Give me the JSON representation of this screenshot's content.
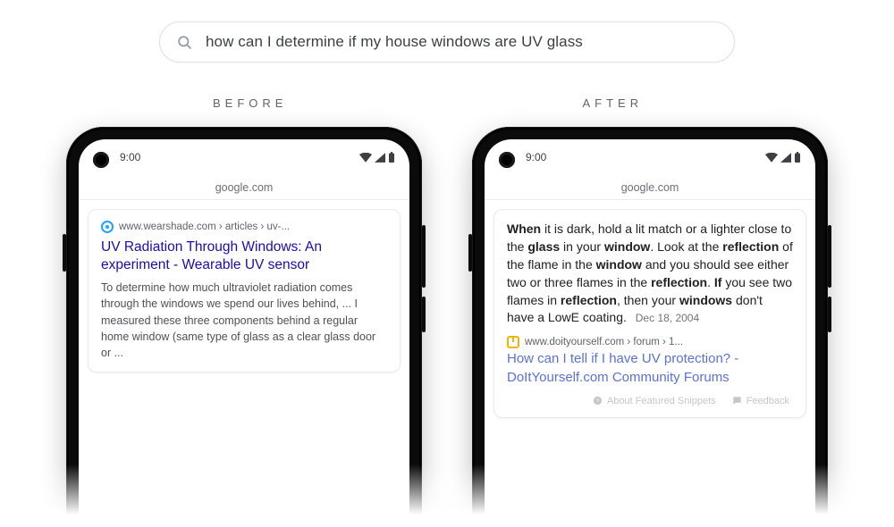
{
  "search": {
    "query": "how can I determine if my house windows are UV glass"
  },
  "labels": {
    "before": "BEFORE",
    "after": "AFTER"
  },
  "phone_common": {
    "time": "9:00",
    "url": "google.com"
  },
  "before": {
    "breadcrumb": "www.wearshade.com › articles › uv-...",
    "title": "UV Radiation Through Windows: An experiment - Wearable UV sensor",
    "snippet": "To determine how much ultraviolet radiation comes through the windows we spend our lives behind, ... I measured these three components behind a regular home window (same type of glass as a clear glass door or  ..."
  },
  "after": {
    "snippet_parts": [
      {
        "b": true,
        "t": "When"
      },
      {
        "b": false,
        "t": " it is dark, hold a lit match or a lighter close to the "
      },
      {
        "b": true,
        "t": "glass"
      },
      {
        "b": false,
        "t": " in your "
      },
      {
        "b": true,
        "t": "window"
      },
      {
        "b": false,
        "t": ". Look at the "
      },
      {
        "b": true,
        "t": "reflection"
      },
      {
        "b": false,
        "t": " of the flame in the "
      },
      {
        "b": true,
        "t": "window"
      },
      {
        "b": false,
        "t": " and you should see either two or three flames in the "
      },
      {
        "b": true,
        "t": "reflection"
      },
      {
        "b": false,
        "t": ". "
      },
      {
        "b": true,
        "t": "If"
      },
      {
        "b": false,
        "t": " you see two flames in "
      },
      {
        "b": true,
        "t": "reflection"
      },
      {
        "b": false,
        "t": ", then your "
      },
      {
        "b": true,
        "t": "windows"
      },
      {
        "b": false,
        "t": " don't have a LowE coating."
      }
    ],
    "date": "Dec 18, 2004",
    "breadcrumb": "www.doityourself.com › forum › 1...",
    "title": "How can I tell if I have UV protection? - DoItYourself.com Community Forums",
    "footer": {
      "about": "About Featured Snippets",
      "feedback": "Feedback"
    }
  }
}
